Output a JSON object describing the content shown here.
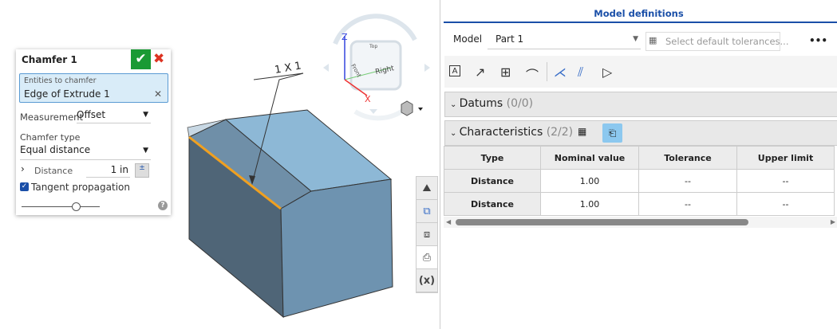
{
  "dialog": {
    "title": "Chamfer 1",
    "entities_label": "Entities to chamfer",
    "entities_value": "Edge of Extrude 1",
    "measurement_label": "Measurement",
    "measurement_value": "Offset",
    "chamfer_type_label": "Chamfer type",
    "chamfer_type_value": "Equal distance",
    "distance_label": "Distance",
    "distance_value": "1 in",
    "tangent_label": "Tangent propagation",
    "tangent_checked": true,
    "slider_fraction": 0.7
  },
  "viewport": {
    "annotation": "1 X 1",
    "viewcube": {
      "top": "Top",
      "front": "Front",
      "right": "Right",
      "axis_z": "Z",
      "axis_x": "X"
    },
    "edge_color": "#f0a020"
  },
  "panel": {
    "title": "Model definitions",
    "model_label": "Model",
    "model_value": "Part 1",
    "tolerance_placeholder": "Select default tolerances...",
    "more": "•••",
    "datums_label": "Datums",
    "datums_count": "(0/0)",
    "characteristics_label": "Characteristics",
    "characteristics_count": "(2/2)",
    "columns": [
      "Type",
      "Nominal value",
      "Tolerance",
      "Upper limit"
    ],
    "rows": [
      [
        "Distance",
        "1.00",
        "--",
        "--"
      ],
      [
        "Distance",
        "1.00",
        "--",
        "--"
      ]
    ],
    "scroll_fraction": 0.78
  }
}
